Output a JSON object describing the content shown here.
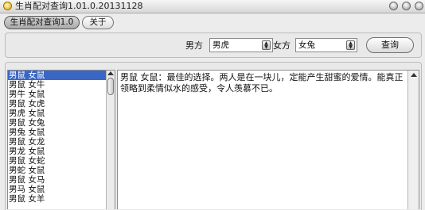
{
  "window": {
    "title": "生肖配对查询1.01.0.20131128"
  },
  "tabs": [
    {
      "label": "生肖配对查询1.0",
      "active": true
    },
    {
      "label": "关于",
      "active": false
    }
  ],
  "query": {
    "male_label": "男方",
    "male_value": "男虎",
    "female_label": "女方",
    "female_value": "女兔",
    "button_label": "查询"
  },
  "pairs": [
    "男鼠 女鼠",
    "男鼠 女牛",
    "男牛 女鼠",
    "男鼠 女虎",
    "男虎 女鼠",
    "男鼠 女兔",
    "男兔 女鼠",
    "男鼠 女龙",
    "男龙 女鼠",
    "男鼠 女蛇",
    "男蛇 女鼠",
    "男鼠 女马",
    "男马 女鼠",
    "男鼠 女羊"
  ],
  "selected_index": 0,
  "detail": {
    "text": "男鼠 女鼠：最佳的选择。两人是在一块儿，定能产生甜蜜的爱情。能真正领略到柔情似水的感受，令人羡慕不已。"
  }
}
